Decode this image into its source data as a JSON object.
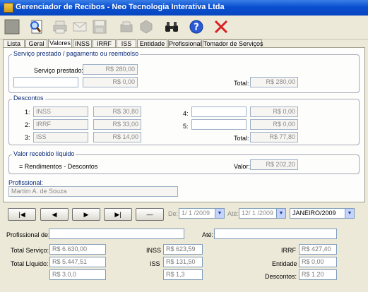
{
  "window": {
    "title": "Gerenciador de Recibos - Neo Tecnologia Interativa Ltda"
  },
  "toolbar": {
    "buttons": [
      {
        "name": "new-icon",
        "color": "#8a8a80"
      },
      {
        "name": "search-document-icon",
        "color": "#4a7ad8"
      },
      {
        "name": "print-icon",
        "color": "#9a9a90"
      },
      {
        "name": "email-icon",
        "color": "#9a9a90"
      },
      {
        "name": "save-icon",
        "color": "#9a9a90"
      },
      {
        "name": "print-preview-icon",
        "color": "#9a9a90"
      },
      {
        "name": "settings-icon",
        "color": "#9a9a90"
      },
      {
        "name": "binoculars-icon",
        "color": "#202020"
      },
      {
        "name": "help-icon",
        "color": "#2a5ad8"
      },
      {
        "name": "close-icon",
        "color": "#d82020"
      }
    ]
  },
  "tabs": [
    "Lista",
    "Geral",
    "Valores",
    "INSS",
    "IRRF",
    "ISS",
    "Entidade",
    "Profissional",
    "Tomador de Serviços"
  ],
  "active_tab": "Valores",
  "servico": {
    "legend": "Serviço prestado / pagamento ou reembolso",
    "label": "Serviço prestado:",
    "value": "R$ 280,00",
    "extra_value": "R$ 0,00",
    "total_label": "Total:",
    "total": "R$ 280,00"
  },
  "descontos": {
    "legend": "Descontos",
    "items": [
      {
        "num": "1:",
        "name": "INSS",
        "value": "R$ 30,80"
      },
      {
        "num": "2:",
        "name": "IRRF",
        "value": "R$ 33,00"
      },
      {
        "num": "3:",
        "name": "ISS",
        "value": "R$ 14,00"
      },
      {
        "num": "4:",
        "name": "",
        "value": "R$ 0,00"
      },
      {
        "num": "5:",
        "name": "",
        "value": "R$ 0,00"
      }
    ],
    "total_label": "Total:",
    "total": "R$ 77,80"
  },
  "liquido": {
    "legend": "Valor recebido líquido",
    "formula": "= Rendimentos - Descontos",
    "label": "Valor:",
    "value": "R$ 202,20"
  },
  "profissional": {
    "label": "Profissional:",
    "value": "Martim A. de Souza"
  },
  "nav": {
    "first": "|◀",
    "prev": "◀",
    "next": "▶",
    "last": "▶|",
    "delete": "—"
  },
  "period": {
    "de_label": "De:",
    "de_value": "1/ 1 /2009",
    "ate_label": "Até:",
    "ate_value": "12/ 1 /2009",
    "month_value": "JANEIRO/2009"
  },
  "filter": {
    "prof_label": "Profissional de:",
    "ate_label": "Até:"
  },
  "summary": {
    "total_servico_label": "Total Serviço:",
    "total_servico": "R$ 6.630,00",
    "total_liquido_label": "Total Líquido:",
    "total_liquido": "R$ 5.447,51",
    "row3_value": "R$ 3.0,0",
    "inss_label": "INSS",
    "inss": "R$ 623,59",
    "iss_label": "ISS",
    "iss": "R$ 131,50",
    "row3_mid": "R$ 1,3",
    "irrf_label": "IRRF",
    "irrf": "R$ 427,40",
    "entidade_label": "Entidade",
    "entidade": "R$ 0,00",
    "descontos_label": "Descontos:",
    "descontos": "R$ 1.20"
  }
}
